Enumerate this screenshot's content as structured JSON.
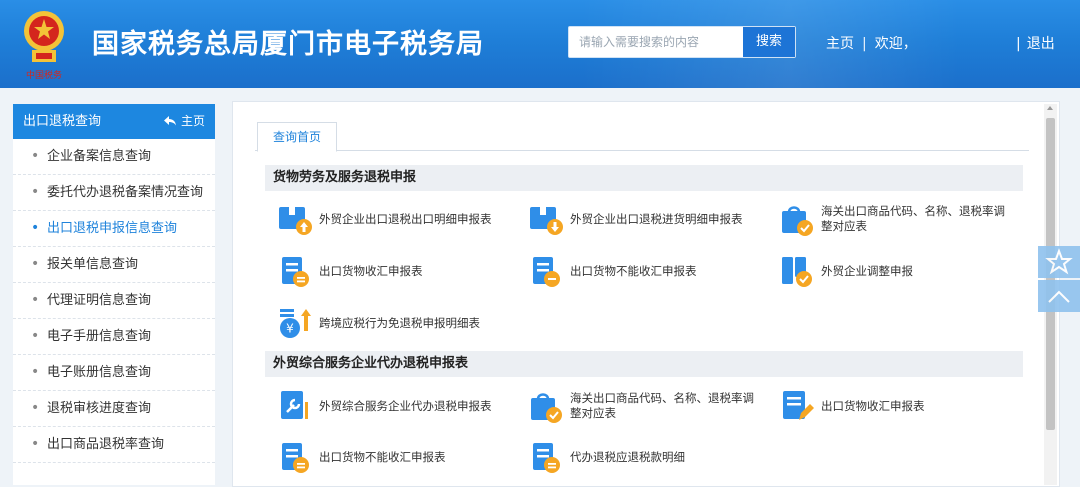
{
  "header": {
    "site_title": "国家税务总局厦门市电子税务局",
    "search_placeholder": "请输入需要搜索的内容",
    "search_button": "搜索",
    "nav_home": "主页",
    "nav_welcome": "欢迎，",
    "nav_logout": "退出",
    "nav_separator": "|",
    "logo_caption": "中国税务"
  },
  "sidebar": {
    "title": "出口退税查询",
    "home_link": "主页",
    "items": [
      {
        "label": "企业备案信息查询"
      },
      {
        "label": "委托代办退税备案情况查询"
      },
      {
        "label": "出口退税申报信息查询"
      },
      {
        "label": "报关单信息查询"
      },
      {
        "label": "代理证明信息查询"
      },
      {
        "label": "电子手册信息查询"
      },
      {
        "label": "电子账册信息查询"
      },
      {
        "label": "退税审核进度查询"
      },
      {
        "label": "出口商品退税率查询"
      }
    ],
    "active_index": 2
  },
  "main": {
    "tab_label": "查询首页",
    "sections": [
      {
        "title": "货物劳务及服务退税申报",
        "items": [
          {
            "label": "外贸企业出口退税出口明细申报表",
            "icon": "box-upload-icon"
          },
          {
            "label": "外贸企业出口退税进货明细申报表",
            "icon": "box-download-icon"
          },
          {
            "label": "海关出口商品代码、名称、退税率调整对应表",
            "icon": "bag-check-icon"
          },
          {
            "label": "出口货物收汇申报表",
            "icon": "doc-yen-icon"
          },
          {
            "label": "出口货物不能收汇申报表",
            "icon": "doc-minus-icon"
          },
          {
            "label": "外贸企业调整申报",
            "icon": "doc-check-icon"
          },
          {
            "label": "跨境应税行为免退税申报明细表",
            "icon": "coin-upload-icon"
          }
        ]
      },
      {
        "title": "外贸综合服务企业代办退税申报表",
        "items": [
          {
            "label": "外贸综合服务企业代办退税申报表",
            "icon": "doc-wrench-icon"
          },
          {
            "label": "海关出口商品代码、名称、退税率调整对应表",
            "icon": "bag-check-icon"
          },
          {
            "label": "出口货物收汇申报表",
            "icon": "doc-pen-icon"
          },
          {
            "label": "出口货物不能收汇申报表",
            "icon": "doc-yen-icon"
          },
          {
            "label": "代办退税应退税款明细",
            "icon": "doc-yen-icon"
          }
        ]
      }
    ]
  },
  "colors": {
    "header_blue": "#1f7fd8",
    "accent_blue": "#1f83db",
    "icon_orange": "#f5a623"
  }
}
